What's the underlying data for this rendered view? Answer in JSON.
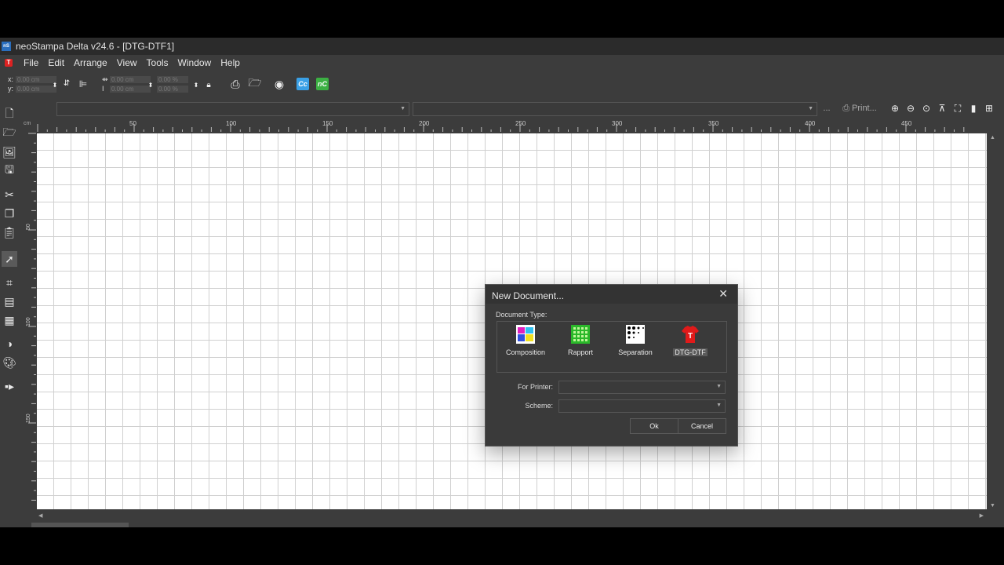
{
  "window": {
    "title": "neoStampa Delta  v24.6 - [DTG-DTF1]",
    "app_icon": "nS"
  },
  "menu": [
    "File",
    "Edit",
    "Arrange",
    "View",
    "Tools",
    "Window",
    "Help"
  ],
  "coords": {
    "x_label": "x:",
    "y_label": "y:",
    "x_value": "0.00 cm",
    "y_value": "0.00 cm",
    "w_value": "0.00 cm",
    "h_value": "0.00 cm",
    "scale_x": "0.00 %",
    "scale_y": "0.00 %"
  },
  "toolbar_icons": [
    "printer-icon",
    "folder-export-icon",
    "webcam-icon",
    "cc-icon",
    "nc-icon"
  ],
  "toolbar": {
    "cc_label": "Cc",
    "nc_label": "nC"
  },
  "combobar": {
    "more_label": "...",
    "print_label": "Print..."
  },
  "ruler": {
    "unit": "cm",
    "ticks": [
      "50",
      "100",
      "150",
      "200",
      "250",
      "300",
      "350",
      "400",
      "450"
    ],
    "left_ticks": [
      "50",
      "100",
      "150"
    ]
  },
  "dialog": {
    "title": "New Document...",
    "doc_type_label": "Document Type:",
    "types": [
      {
        "label": "Composition",
        "icon": "composition-icon",
        "selected": false
      },
      {
        "label": "Rapport",
        "icon": "rapport-icon",
        "selected": false
      },
      {
        "label": "Separation",
        "icon": "separation-icon",
        "selected": false
      },
      {
        "label": "DTG-DTF",
        "icon": "tshirt-icon",
        "selected": true
      }
    ],
    "printer_label": "For Printer:",
    "printer_value": "",
    "scheme_label": "Scheme:",
    "scheme_value": "",
    "ok_label": "Ok",
    "cancel_label": "Cancel"
  },
  "colors": {
    "accent_red": "#dd2222",
    "cc_blue": "#3aa0e6",
    "nc_green": "#3cb043"
  }
}
